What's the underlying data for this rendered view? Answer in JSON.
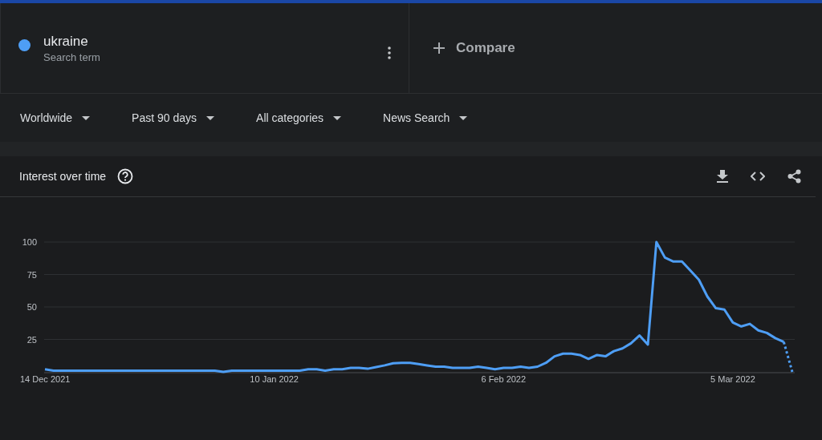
{
  "search_terms": [
    {
      "term": "ukraine",
      "subtitle": "Search term",
      "color": "#4e9ef5"
    }
  ],
  "compare": {
    "label": "Compare"
  },
  "filters": [
    {
      "label": "Worldwide"
    },
    {
      "label": "Past 90 days"
    },
    {
      "label": "All categories"
    },
    {
      "label": "News Search"
    }
  ],
  "interest_card": {
    "title": "Interest over time",
    "chart_data": {
      "type": "line",
      "grid": true,
      "ylim": [
        0,
        100
      ],
      "yticks": [
        25,
        50,
        75,
        100
      ],
      "categories": [
        "14 Dec 2021",
        null,
        null,
        null,
        null,
        null,
        null,
        null,
        null,
        null,
        null,
        null,
        null,
        null,
        null,
        null,
        null,
        null,
        null,
        null,
        null,
        null,
        null,
        null,
        null,
        null,
        null,
        "10 Jan 2022",
        null,
        null,
        null,
        null,
        null,
        null,
        null,
        null,
        null,
        null,
        null,
        null,
        null,
        null,
        null,
        null,
        null,
        null,
        null,
        null,
        null,
        null,
        null,
        null,
        null,
        null,
        "6 Feb 2022",
        null,
        null,
        null,
        null,
        null,
        null,
        null,
        null,
        null,
        null,
        null,
        null,
        null,
        null,
        null,
        null,
        null,
        null,
        null,
        null,
        null,
        null,
        null,
        null,
        null,
        null,
        "5 Mar 2022",
        null,
        null,
        null,
        null,
        null,
        null,
        null
      ],
      "series": [
        {
          "color": "#4e9ef5",
          "line_style": "solid",
          "values": [
            2,
            1,
            1,
            1,
            1,
            1,
            1,
            1,
            1,
            1,
            1,
            1,
            1,
            1,
            1,
            1,
            1,
            1,
            1,
            1,
            1,
            0,
            1,
            1,
            1,
            1,
            1,
            1,
            1,
            1,
            1,
            2,
            2,
            1,
            2,
            2,
            3,
            3,
            2.4,
            3.7,
            5,
            6.6,
            7,
            7,
            6,
            5,
            4,
            4,
            3,
            3,
            3,
            4,
            3,
            2,
            3,
            3,
            4,
            3,
            4,
            7,
            12,
            14,
            14,
            13,
            10,
            13,
            12,
            16,
            18,
            22,
            28,
            21,
            100,
            88,
            85,
            85,
            78,
            71,
            58,
            49,
            48,
            38,
            35,
            37,
            32,
            30,
            26,
            23,
            null
          ]
        },
        {
          "color": "#4e9ef5",
          "line_style": "dotted",
          "values": [
            null,
            null,
            null,
            null,
            null,
            null,
            null,
            null,
            null,
            null,
            null,
            null,
            null,
            null,
            null,
            null,
            null,
            null,
            null,
            null,
            null,
            null,
            null,
            null,
            null,
            null,
            null,
            null,
            null,
            null,
            null,
            null,
            null,
            null,
            null,
            null,
            null,
            null,
            null,
            null,
            null,
            null,
            null,
            null,
            null,
            null,
            null,
            null,
            null,
            null,
            null,
            null,
            null,
            null,
            null,
            null,
            null,
            null,
            null,
            null,
            null,
            null,
            null,
            null,
            null,
            null,
            null,
            null,
            null,
            null,
            null,
            null,
            null,
            null,
            null,
            null,
            null,
            null,
            null,
            null,
            null,
            null,
            null,
            null,
            null,
            null,
            null,
            23,
            0
          ]
        }
      ]
    }
  }
}
